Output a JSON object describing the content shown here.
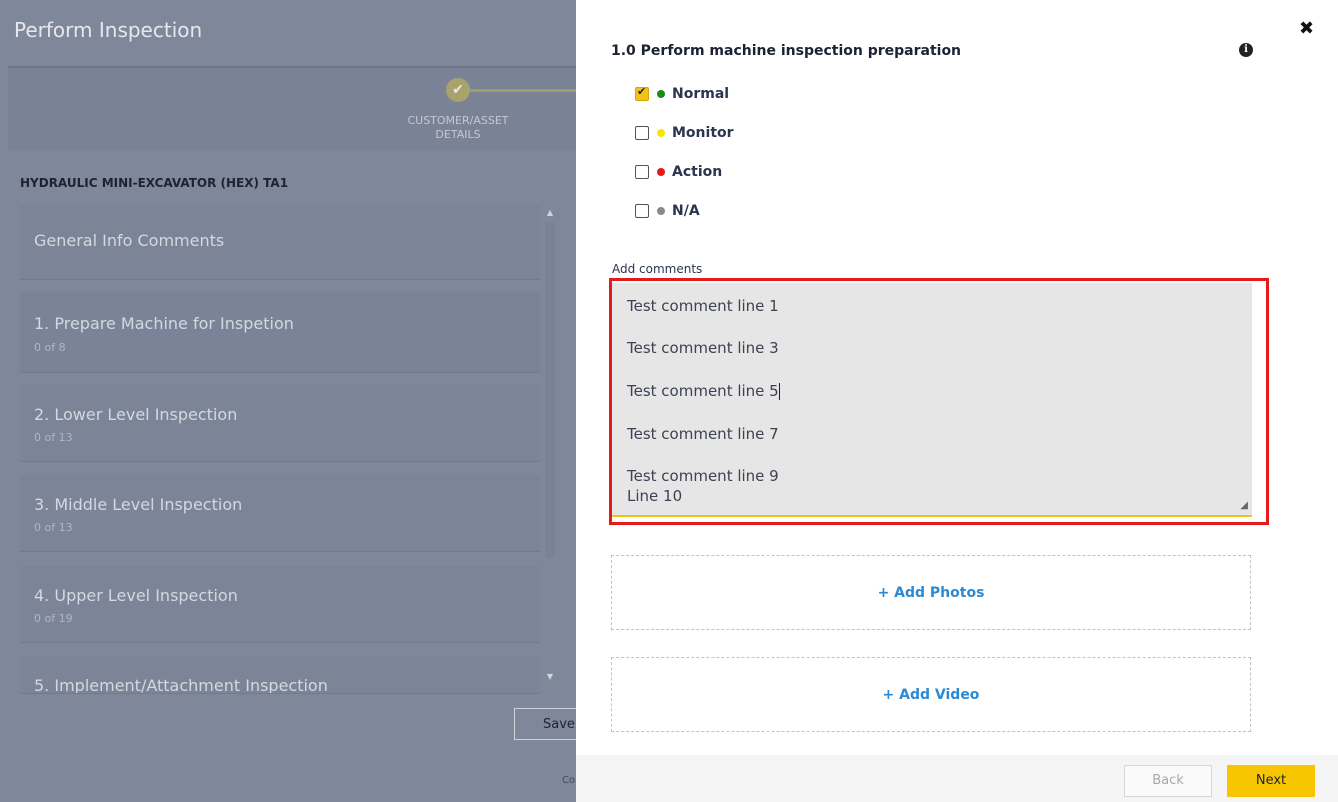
{
  "background": {
    "title": "Perform Inspection",
    "stepper": {
      "step_label": "CUSTOMER/ASSET\nDETAILS"
    },
    "machine_title": "HYDRAULIC MINI-EXCAVATOR (HEX) TA1",
    "cards": [
      {
        "title": "General Info Comments",
        "sub": ""
      },
      {
        "title": "1. Prepare Machine for Inspetion",
        "sub": "0 of 8"
      },
      {
        "title": "2. Lower Level Inspection",
        "sub": "0 of 13"
      },
      {
        "title": "3. Middle Level Inspection",
        "sub": "0 of 13"
      },
      {
        "title": "4. Upper Level Inspection",
        "sub": "0 of 19"
      },
      {
        "title": "5. Implement/Attachment Inspection",
        "sub": ""
      }
    ],
    "save_label": "Save",
    "footer_fragment": "Co"
  },
  "panel": {
    "question_title": "1.0 Perform machine inspection preparation",
    "options": [
      {
        "label": "Normal",
        "checked": true,
        "dot_color": "#1a8c1a"
      },
      {
        "label": "Monitor",
        "checked": false,
        "dot_color": "#f5e600"
      },
      {
        "label": "Action",
        "checked": false,
        "dot_color": "#e81818"
      },
      {
        "label": "N/A",
        "checked": false,
        "dot_color": "#8a8a8a"
      }
    ],
    "comments_label": "Add comments",
    "comment_lines": [
      "Test comment line 1",
      "Test comment line 3",
      "Test comment line 5",
      "Test comment line 7",
      "Test comment line 9",
      "Line 10"
    ],
    "add_photos_label": "+ Add Photos",
    "add_video_label": "+ Add Video",
    "back_label": "Back",
    "next_label": "Next"
  },
  "colors": {
    "accent": "#f7c600",
    "highlight": "#e51a1a",
    "link": "#2b8ad3"
  }
}
